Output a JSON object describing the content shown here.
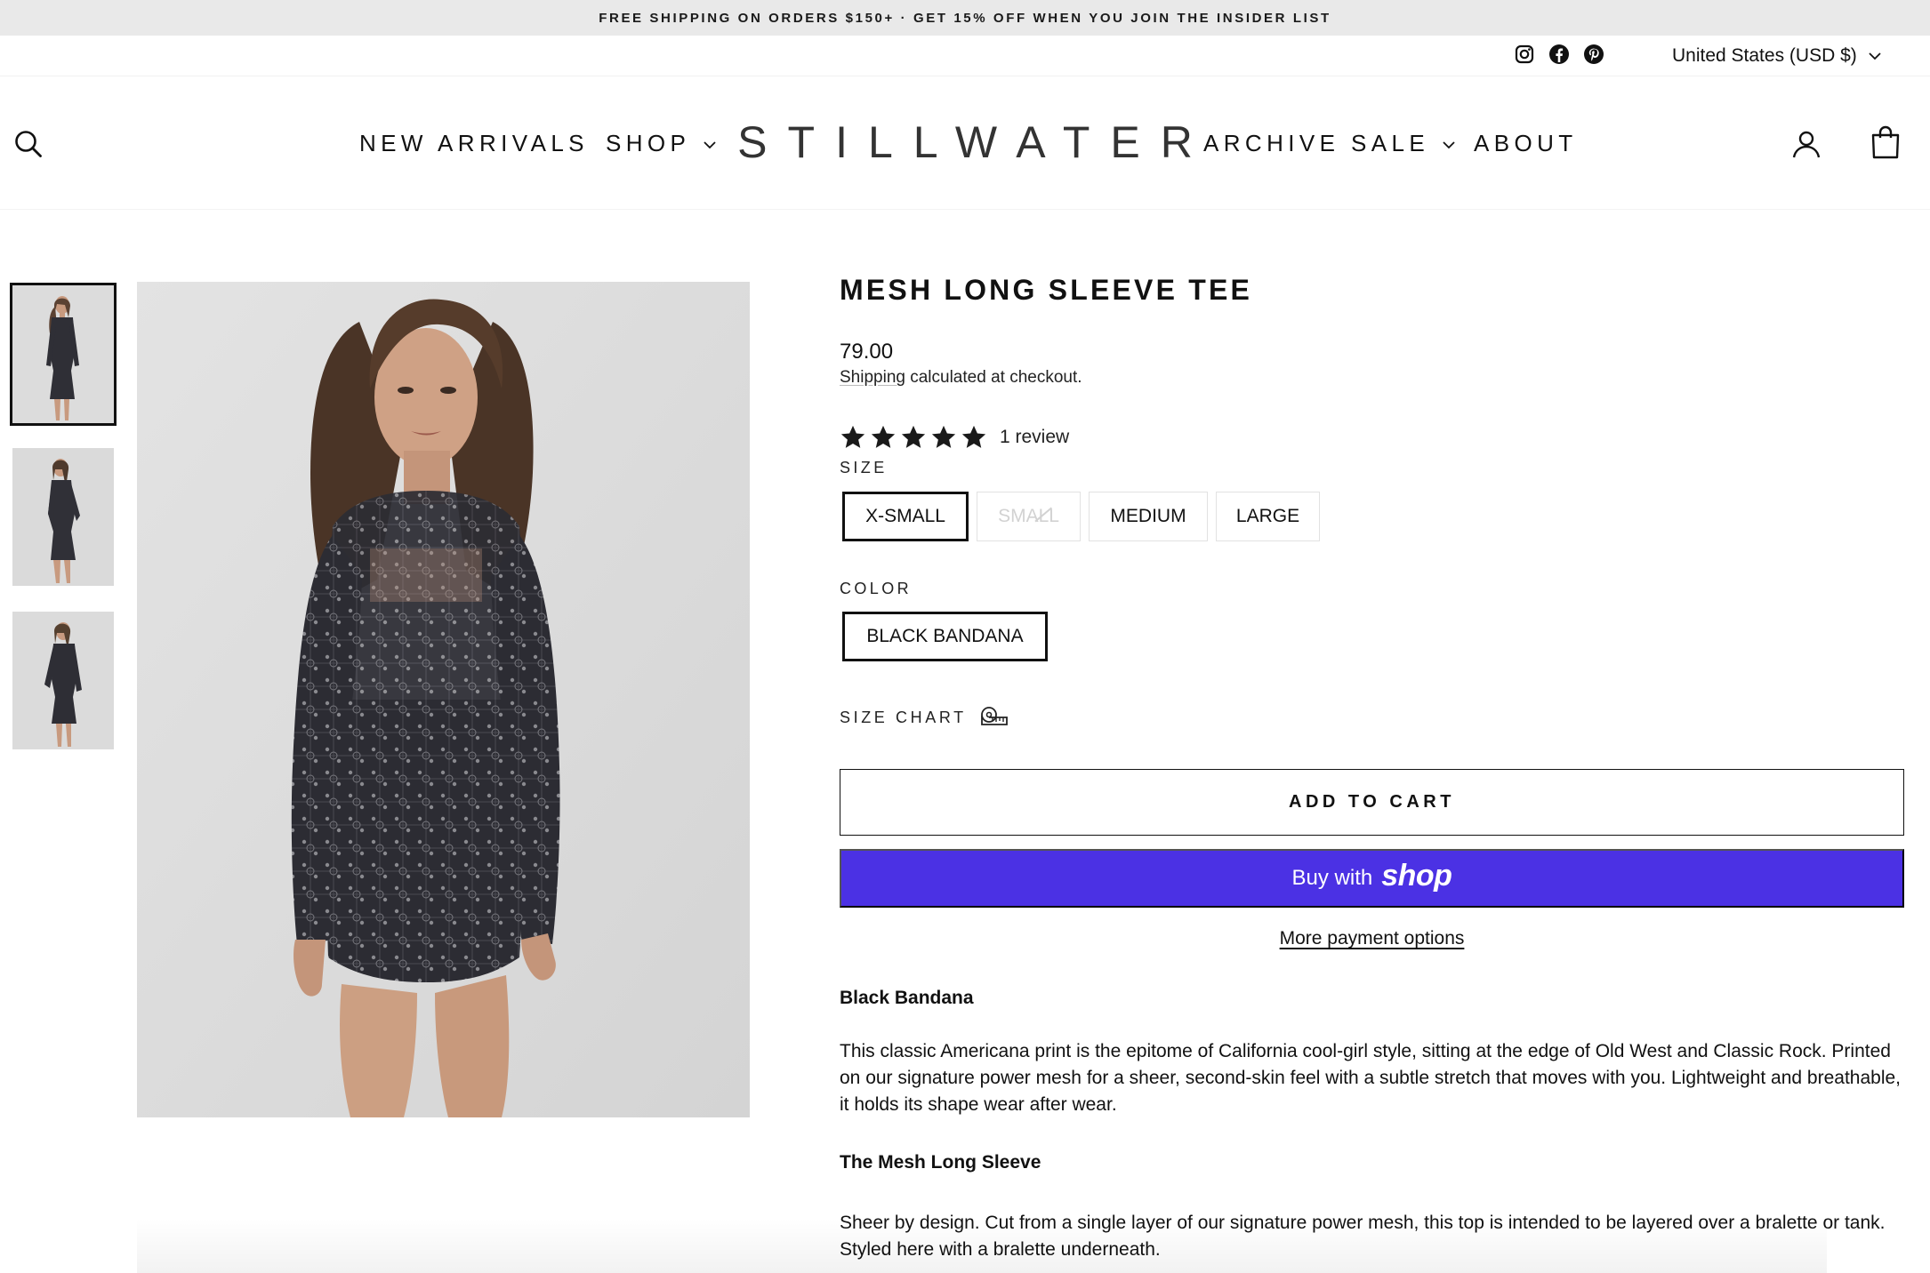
{
  "announcement": "FREE SHIPPING ON ORDERS $150+ · GET 15% OFF WHEN YOU JOIN THE INSIDER LIST",
  "utility": {
    "social": [
      "instagram-icon",
      "facebook-icon",
      "pinterest-icon"
    ],
    "currency": "United States (USD $)"
  },
  "header": {
    "logo": "STILLWATER",
    "nav": {
      "new_arrivals": "NEW ARRIVALS",
      "shop": "SHOP",
      "archive_sale": "ARCHIVE SALE",
      "about": "ABOUT"
    },
    "icons": [
      "search-icon",
      "account-icon",
      "cart-icon"
    ]
  },
  "gallery": {
    "thumbnails": 3,
    "active_thumbnail": 1
  },
  "product": {
    "title": "MESH LONG SLEEVE TEE",
    "price": "79.00",
    "shipping_link": "Shipping",
    "shipping_rest": " calculated at checkout.",
    "rating": 5,
    "review_count": "1 review",
    "size_label": "SIZE",
    "sizes": [
      {
        "label": "X-SMALL",
        "state": "selected"
      },
      {
        "label": "SMALL",
        "state": "unavailable"
      },
      {
        "label": "MEDIUM",
        "state": "available"
      },
      {
        "label": "LARGE",
        "state": "available"
      }
    ],
    "color_label": "COLOR",
    "colors": [
      {
        "label": "BLACK BANDANA",
        "state": "selected"
      }
    ],
    "size_chart": "SIZE CHART",
    "add_to_cart": "ADD TO CART",
    "buy_with": "Buy with",
    "buy_with_brand": "shop",
    "more_payment": "More payment options",
    "shop_pay_color": "#4b31e4",
    "description": [
      {
        "heading": "Black Bandana",
        "text": "This classic Americana print is the epitome of California cool-girl style, sitting at the edge of Old West and Classic Rock. Printed on our signature power mesh for a sheer, second-skin feel with a subtle stretch that moves with you. Lightweight and breathable, it holds its shape wear after wear."
      },
      {
        "heading": "The Mesh Long Sleeve",
        "text": "Sheer by design. Cut from a single layer of our signature power mesh, this top is intended to be layered over a bralette or tank. Styled here with a bralette underneath."
      }
    ]
  }
}
